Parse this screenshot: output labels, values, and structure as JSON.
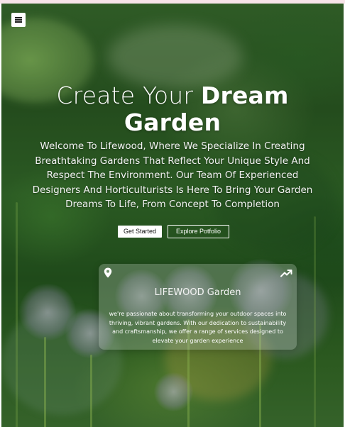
{
  "nav": {
    "menu_icon": "hamburger-menu-icon"
  },
  "hero": {
    "headline_light": "Create Your ",
    "headline_bold_1": "Dream",
    "headline_bold_2": "Garden",
    "description": "Welcome To Lifewood, Where We Specialize In Creating Breathtaking Gardens That Reflect Your Unique Style And Respect The Environment. Our Team Of Experienced Designers And Horticulturists Is Here To Bring Your Garden Dreams To Life, From Concept To Completion",
    "primary_button": "Get Started",
    "secondary_button": "Explore Potfolio"
  },
  "card": {
    "pin_icon": "location-pin-icon",
    "trend_icon": "trending-up-icon",
    "title": "LIFEWOOD Garden",
    "text": "we're passionate about transforming your outdoor spaces into thriving, vibrant gardens. With our dedication to sustainability and craftsmanship, we offer a range of services designed to elevate your garden experience"
  },
  "colors": {
    "text": "#ffffff",
    "foliage_dark": "#244c1d",
    "foliage_mid": "#2f5b26",
    "top_strip": "#f7e4e9"
  }
}
